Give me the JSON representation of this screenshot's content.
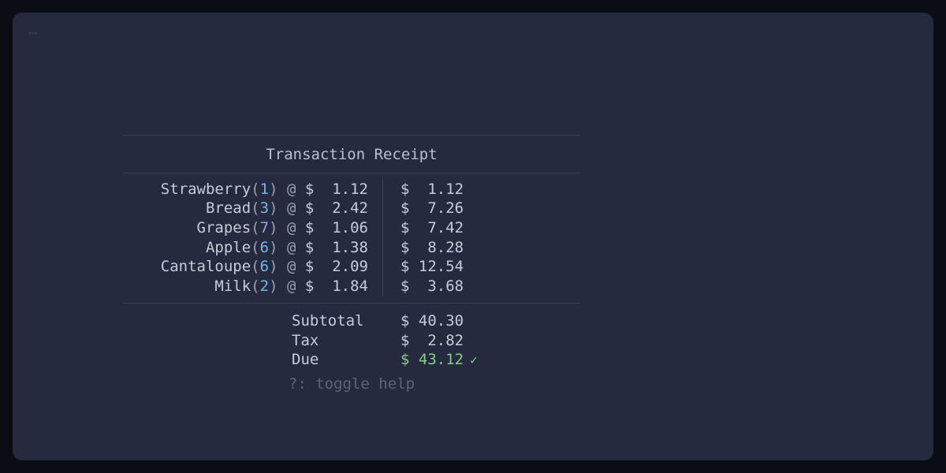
{
  "terminal": {
    "corner_marker": "⋯"
  },
  "receipt": {
    "title": "Transaction Receipt",
    "items": [
      {
        "name": "Strawberry",
        "qty": "1",
        "unit": "1.12",
        "total": "1.12"
      },
      {
        "name": "Bread",
        "qty": "3",
        "unit": "2.42",
        "total": "7.26"
      },
      {
        "name": "Grapes",
        "qty": "7",
        "unit": "1.06",
        "total": "7.42"
      },
      {
        "name": "Apple",
        "qty": "6",
        "unit": "1.38",
        "total": "8.28"
      },
      {
        "name": "Cantaloupe",
        "qty": "6",
        "unit": "2.09",
        "total": "12.54"
      },
      {
        "name": "Milk",
        "qty": "2",
        "unit": "1.84",
        "total": "3.68"
      }
    ],
    "subtotal_label": "Subtotal",
    "subtotal": "40.30",
    "tax_label": "Tax",
    "tax": "2.82",
    "due_label": "Due",
    "due": "43.12",
    "check": "✓",
    "hint": "?: toggle help",
    "at_symbol": "@",
    "currency": "$",
    "lparen": "(",
    "rparen": ")"
  }
}
